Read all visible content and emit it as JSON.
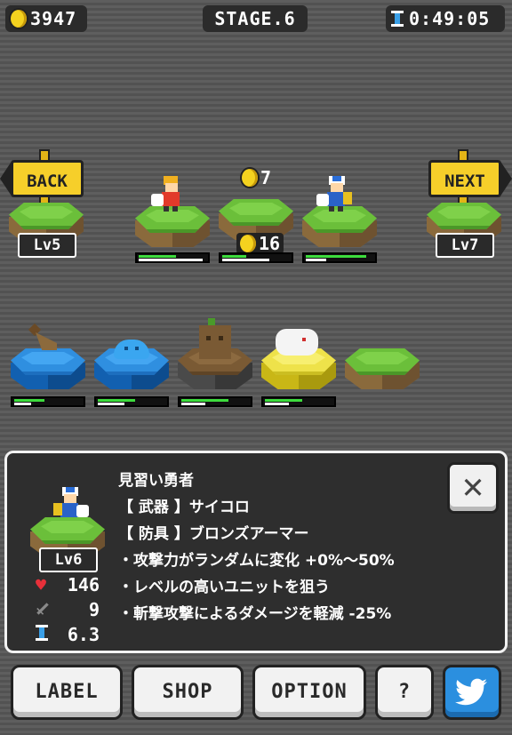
{
  "topbar": {
    "coins": "3947",
    "stage": "STAGE.6",
    "timer": "0:49:05"
  },
  "navigation": {
    "back_label": "BACK",
    "back_level": "Lv5",
    "next_label": "NEXT",
    "next_level": "Lv7"
  },
  "shop_cost": "7",
  "reward": "16",
  "party": [
    {
      "name": "red-hero",
      "hp": 0.55,
      "xp": 0.95
    },
    {
      "name": "empty-slot",
      "hp": 0.35,
      "xp": 0.7
    },
    {
      "name": "blue-hero",
      "hp": 0.9,
      "xp": 0.3
    }
  ],
  "enemies": [
    {
      "name": "drill",
      "hp": 0.45,
      "xp": 0.25
    },
    {
      "name": "slime",
      "hp": 0.55,
      "xp": 0.4
    },
    {
      "name": "tree-stump",
      "hp": 0.7,
      "xp": 0.35
    },
    {
      "name": "sheep",
      "hp": 0.55,
      "xp": 0.35
    }
  ],
  "info": {
    "unit_name": "見習い勇者",
    "weapon": "【 武器 】サイコロ",
    "armor": "【 防具 】ブロンズアーマー",
    "trait1": "・攻撃力がランダムに変化 +0%〜50%",
    "trait2": "・レベルの高いユニットを狙う",
    "trait3": "・斬撃攻撃によるダメージを軽減 -25%",
    "level": "Lv6",
    "hp_value": "146",
    "attack_value": "9",
    "speed_value": "6.3",
    "close_symbol": "✕"
  },
  "buttons": {
    "label": "LABEL",
    "shop": "SHOP",
    "option": "OPTION",
    "help": "?"
  },
  "colors": {
    "hp_bar": "#3ddc3d",
    "sign": "#f6cf2a",
    "twitter_button": "#2b8fdf"
  }
}
